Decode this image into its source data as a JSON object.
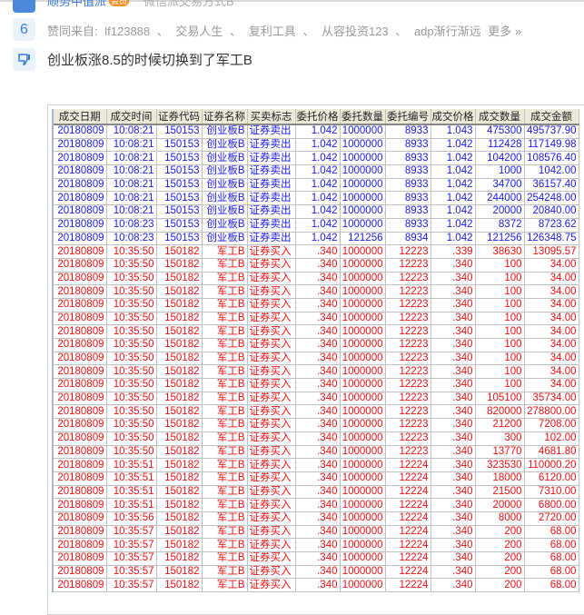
{
  "previous_post": {
    "author": "顺势中值派",
    "badge": "会员",
    "text": "微信派交易方式B"
  },
  "likes": {
    "count": "6",
    "prefix": "赞同来自:",
    "users": [
      "lf123888",
      "、",
      "交易人生",
      "、",
      "复利工具",
      "、",
      "从容投资123",
      "、",
      "adp渐行渐远"
    ],
    "more": "更多 »"
  },
  "comment": {
    "text": "创业板涨8.5的时候切换到了军工B"
  },
  "colors": {
    "sell": "#1a1aee",
    "buy": "#ee1111",
    "accent": "#3a7bd5"
  },
  "table": {
    "headers": [
      "成交日期",
      "成交时间",
      "证券代码",
      "证券名称",
      "买卖标志",
      "委托价格",
      "委托数量",
      "委托编号",
      "成交价格",
      "成交数量",
      "成交金额"
    ],
    "rows": [
      [
        "20180809",
        "10:08:21",
        "150153",
        "创业板B",
        "证券卖出",
        "1.042",
        "1000000",
        "8933",
        "1.043",
        "475300",
        "495737.90"
      ],
      [
        "20180809",
        "10:08:21",
        "150153",
        "创业板B",
        "证券卖出",
        "1.042",
        "1000000",
        "8933",
        "1.042",
        "112428",
        "117149.98"
      ],
      [
        "20180809",
        "10:08:21",
        "150153",
        "创业板B",
        "证券卖出",
        "1.042",
        "1000000",
        "8933",
        "1.042",
        "104200",
        "108576.40"
      ],
      [
        "20180809",
        "10:08:21",
        "150153",
        "创业板B",
        "证券卖出",
        "1.042",
        "1000000",
        "8933",
        "1.042",
        "1000",
        "1042.00"
      ],
      [
        "20180809",
        "10:08:21",
        "150153",
        "创业板B",
        "证券卖出",
        "1.042",
        "1000000",
        "8933",
        "1.042",
        "34700",
        "36157.40"
      ],
      [
        "20180809",
        "10:08:21",
        "150153",
        "创业板B",
        "证券卖出",
        "1.042",
        "1000000",
        "8933",
        "1.042",
        "244000",
        "254248.00"
      ],
      [
        "20180809",
        "10:08:21",
        "150153",
        "创业板B",
        "证券卖出",
        "1.042",
        "1000000",
        "8933",
        "1.042",
        "20000",
        "20840.00"
      ],
      [
        "20180809",
        "10:08:23",
        "150153",
        "创业板B",
        "证券卖出",
        "1.042",
        "1000000",
        "8933",
        "1.042",
        "8372",
        "8723.62"
      ],
      [
        "20180809",
        "10:08:23",
        "150153",
        "创业板B",
        "证券卖出",
        "1.042",
        "121256",
        "8934",
        "1.042",
        "121256",
        "126348.75"
      ],
      [
        "20180809",
        "10:35:50",
        "150182",
        "军工B",
        "证券买入",
        ".340",
        "1000000",
        "12223",
        ".339",
        "38630",
        "13095.57"
      ],
      [
        "20180809",
        "10:35:50",
        "150182",
        "军工B",
        "证券买入",
        ".340",
        "1000000",
        "12223",
        ".340",
        "100",
        "34.00"
      ],
      [
        "20180809",
        "10:35:50",
        "150182",
        "军工B",
        "证券买入",
        ".340",
        "1000000",
        "12223",
        ".340",
        "100",
        "34.00"
      ],
      [
        "20180809",
        "10:35:50",
        "150182",
        "军工B",
        "证券买入",
        ".340",
        "1000000",
        "12223",
        ".340",
        "100",
        "34.00"
      ],
      [
        "20180809",
        "10:35:50",
        "150182",
        "军工B",
        "证券买入",
        ".340",
        "1000000",
        "12223",
        ".340",
        "100",
        "34.00"
      ],
      [
        "20180809",
        "10:35:50",
        "150182",
        "军工B",
        "证券买入",
        ".340",
        "1000000",
        "12223",
        ".340",
        "100",
        "34.00"
      ],
      [
        "20180809",
        "10:35:50",
        "150182",
        "军工B",
        "证券买入",
        ".340",
        "1000000",
        "12223",
        ".340",
        "100",
        "34.00"
      ],
      [
        "20180809",
        "10:35:50",
        "150182",
        "军工B",
        "证券买入",
        ".340",
        "1000000",
        "12223",
        ".340",
        "100",
        "34.00"
      ],
      [
        "20180809",
        "10:35:50",
        "150182",
        "军工B",
        "证券买入",
        ".340",
        "1000000",
        "12223",
        ".340",
        "100",
        "34.00"
      ],
      [
        "20180809",
        "10:35:50",
        "150182",
        "军工B",
        "证券买入",
        ".340",
        "1000000",
        "12223",
        ".340",
        "100",
        "34.00"
      ],
      [
        "20180809",
        "10:35:50",
        "150182",
        "军工B",
        "证券买入",
        ".340",
        "1000000",
        "12223",
        ".340",
        "100",
        "34.00"
      ],
      [
        "20180809",
        "10:35:50",
        "150182",
        "军工B",
        "证券买入",
        ".340",
        "1000000",
        "12223",
        ".340",
        "105100",
        "35734.00"
      ],
      [
        "20180809",
        "10:35:50",
        "150182",
        "军工B",
        "证券买入",
        ".340",
        "1000000",
        "12223",
        ".340",
        "820000",
        "278800.00"
      ],
      [
        "20180809",
        "10:35:50",
        "150182",
        "军工B",
        "证券买入",
        ".340",
        "1000000",
        "12223",
        ".340",
        "21200",
        "7208.00"
      ],
      [
        "20180809",
        "10:35:50",
        "150182",
        "军工B",
        "证券买入",
        ".340",
        "1000000",
        "12223",
        ".340",
        "300",
        "102.00"
      ],
      [
        "20180809",
        "10:35:50",
        "150182",
        "军工B",
        "证券买入",
        ".340",
        "1000000",
        "12223",
        ".340",
        "13770",
        "4681.80"
      ],
      [
        "20180809",
        "10:35:51",
        "150182",
        "军工B",
        "证券买入",
        ".340",
        "1000000",
        "12224",
        ".340",
        "323530",
        "110000.20"
      ],
      [
        "20180809",
        "10:35:51",
        "150182",
        "军工B",
        "证券买入",
        ".340",
        "1000000",
        "12224",
        ".340",
        "18000",
        "6120.00"
      ],
      [
        "20180809",
        "10:35:51",
        "150182",
        "军工B",
        "证券买入",
        ".340",
        "1000000",
        "12224",
        ".340",
        "21500",
        "7310.00"
      ],
      [
        "20180809",
        "10:35:51",
        "150182",
        "军工B",
        "证券买入",
        ".340",
        "1000000",
        "12224",
        ".340",
        "20000",
        "6800.00"
      ],
      [
        "20180809",
        "10:35:56",
        "150182",
        "军工B",
        "证券买入",
        ".340",
        "1000000",
        "12224",
        ".340",
        "8000",
        "2720.00"
      ],
      [
        "20180809",
        "10:35:57",
        "150182",
        "军工B",
        "证券买入",
        ".340",
        "1000000",
        "12224",
        ".340",
        "200",
        "68.00"
      ],
      [
        "20180809",
        "10:35:57",
        "150182",
        "军工B",
        "证券买入",
        ".340",
        "1000000",
        "12224",
        ".340",
        "200",
        "68.00"
      ],
      [
        "20180809",
        "10:35:57",
        "150182",
        "军工B",
        "证券买入",
        ".340",
        "1000000",
        "12224",
        ".340",
        "200",
        "68.00"
      ],
      [
        "20180809",
        "10:35:57",
        "150182",
        "军工B",
        "证券买入",
        ".340",
        "1000000",
        "12224",
        ".340",
        "200",
        "68.00"
      ],
      [
        "20180809",
        "10:35:57",
        "150182",
        "军工B",
        "证券买入",
        ".340",
        "1000000",
        "12224",
        ".340",
        "200",
        "68.00"
      ]
    ]
  }
}
